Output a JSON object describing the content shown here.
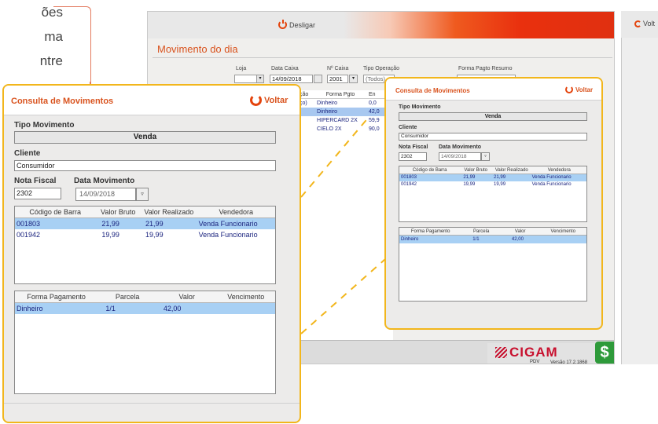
{
  "doc_text": [
    "ões",
    "ma",
    "ntre"
  ],
  "app": {
    "desligar": "Desligar",
    "title": "Movimento do dia",
    "filters": {
      "loja_label": "Loja",
      "data_caixa_label": "Data Caixa",
      "data_caixa_value": "14/09/2018",
      "n_caixa_label": "Nº Caixa",
      "n_caixa_value": "2001",
      "tipo_operacao_label": "Tipo Operação",
      "tipo_operacao_value": "(Todos)",
      "forma_pagto_resumo_label": "Forma Pagto Resumo"
    },
    "grid": {
      "col_a": "ção",
      "col_b": "Forma Pgto",
      "col_c": "En",
      "rows": [
        {
          "a": "ço)",
          "b": "Dinheiro",
          "c": "0,0"
        },
        {
          "a": "",
          "b": "Dinheiro",
          "c": "42,0"
        },
        {
          "a": "",
          "b": "HIPERCARD 2X",
          "c": "59,9"
        },
        {
          "a": "",
          "b": "CIELO 2X",
          "c": "90,0"
        }
      ]
    },
    "brand": "CIGAM",
    "pdv": "PDV",
    "versao": "Versão 17.2.1868",
    "dollar": "$",
    "strip_voltar": "Volt"
  },
  "dialog": {
    "title": "Consulta de Movimentos",
    "voltar": "Voltar",
    "tipo_movimento_label": "Tipo Movimento",
    "tipo_movimento_value": "Venda",
    "cliente_label": "Cliente",
    "cliente_value": "Consumidor",
    "nota_fiscal_label": "Nota Fiscal",
    "nota_fiscal_value": "2302",
    "data_movimento_label": "Data Movimento",
    "data_movimento_value": "14/09/2018",
    "items_headers": [
      "Código de Barra",
      "Valor Bruto",
      "Valor Realizado",
      "Vendedora"
    ],
    "items": [
      [
        "001803",
        "21,99",
        "21,99",
        "Venda Funcionario"
      ],
      [
        "001942",
        "19,99",
        "19,99",
        "Venda Funcionario"
      ]
    ],
    "pay_headers": [
      "Forma Pagamento",
      "Parcela",
      "Valor",
      "Vencimento"
    ],
    "payments": [
      [
        "Dinheiro",
        "1/1",
        "42,00",
        ""
      ]
    ]
  },
  "colors": {
    "accent": "#d9531e",
    "highlight": "#f2b61c",
    "selection": "#a8d0f4",
    "brand_red": "#c8102e",
    "money_green": "#2e9a3a"
  }
}
